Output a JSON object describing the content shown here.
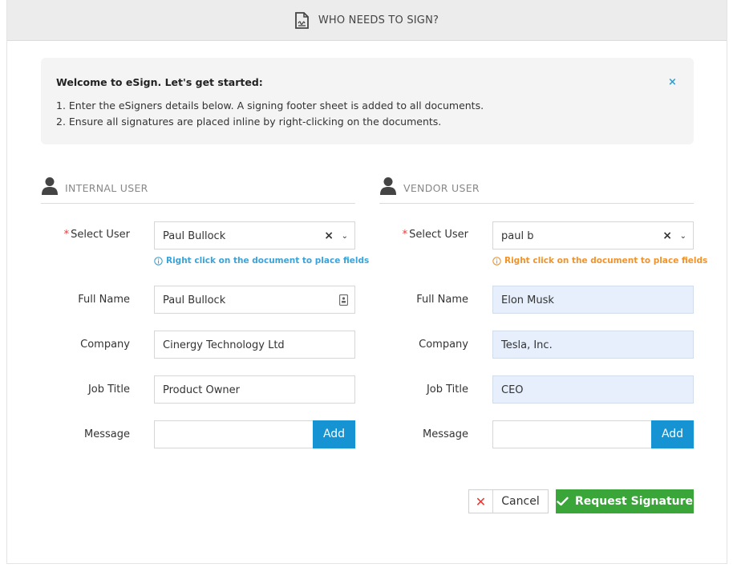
{
  "header": {
    "title": "WHO NEEDS TO SIGN?",
    "icon": "signature-document-icon"
  },
  "welcome": {
    "title": "Welcome to eSign. Let's get started:",
    "lines": [
      "1. Enter the eSigners details below. A signing footer sheet is added to all documents.",
      "2. Ensure all signatures are placed inline by right-clicking on the documents."
    ],
    "close_label": "×"
  },
  "internal": {
    "title": "INTERNAL USER",
    "select_label": "Select User",
    "select_value": "Paul Bullock",
    "hint": "Right click on the document to place fields",
    "full_name_label": "Full Name",
    "full_name": "Paul Bullock",
    "company_label": "Company",
    "company": "Cinergy Technology Ltd",
    "job_title_label": "Job Title",
    "job_title": "Product Owner",
    "message_label": "Message",
    "message": "",
    "add_label": "Add"
  },
  "vendor": {
    "title": "VENDOR USER",
    "select_label": "Select User",
    "select_value": "paul b",
    "hint": "Right click on the document to place fields",
    "full_name_label": "Full Name",
    "full_name": "Elon Musk",
    "company_label": "Company",
    "company": "Tesla, Inc.",
    "job_title_label": "Job Title",
    "job_title": "CEO",
    "message_label": "Message",
    "message": "",
    "add_label": "Add"
  },
  "select_clear": "×",
  "select_chevron": "⌄",
  "required_mark": "*",
  "actions": {
    "cancel_label": "Cancel",
    "request_label": "Request Signature"
  },
  "colors": {
    "accent_blue": "#1693d2",
    "success_green": "#3aa63a",
    "danger_red": "#e53935",
    "hint_orange": "#f0932b",
    "highlight_field": "#e6effb"
  }
}
